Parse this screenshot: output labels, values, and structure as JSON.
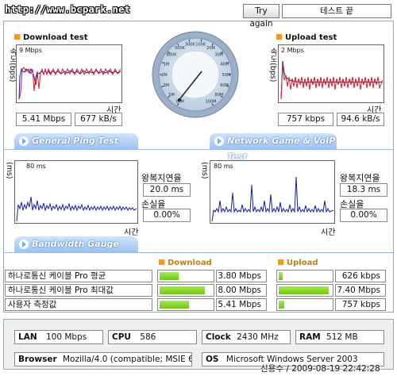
{
  "header": {
    "url_text": "http://www.bcpark.net",
    "try_again": "Try again",
    "status": "테스트 끝"
  },
  "download": {
    "title": "Download test",
    "y_axis": "속도(bps)",
    "y_max": "9 Mbps",
    "x_axis": "시간",
    "mbps": "5.41 Mbps",
    "kbs": "677 kB/s"
  },
  "upload": {
    "title": "Upload test",
    "y_axis": "속도(bps)",
    "y_max": "2 Mbps",
    "x_axis": "시간",
    "kbps": "757 kbps",
    "kbs": "94.6 kB/s"
  },
  "gauge": {
    "labels": [
      "10M",
      "5M",
      "3M",
      "2M",
      "1M",
      "800K",
      "500K",
      "300K",
      "100K",
      "20M",
      "30M",
      "40M",
      "50M",
      "60M",
      "80M",
      "100M"
    ],
    "needle_value": "5.41 Mbps"
  },
  "tabs": {
    "ping": "General Ping Test",
    "game": "Network Game & VoIP Test",
    "bandwidth": "Bandwidth Gauge"
  },
  "ping": {
    "y_axis": "(ms)",
    "y_max": "80 ms",
    "x_axis": "시간",
    "lat_label": "왕복지연율",
    "lat_val": "20.0 ms",
    "loss_label": "손실율",
    "loss_val": "0.00%"
  },
  "game": {
    "y_axis": "(ms)",
    "y_max": "80 ms",
    "x_axis": "시간",
    "lat_label": "왕복지연율",
    "lat_val": "18.3 ms",
    "loss_label": "손실율",
    "loss_val": "0.00%"
  },
  "bandwidth": {
    "download_header": "Download",
    "upload_header": "Upload",
    "rows": [
      {
        "label": "하나로통신 케이블 Pro 평균",
        "down": "3.80 Mbps",
        "down_frac": 0.36,
        "up": "626 kbps",
        "up_frac": 0.08
      },
      {
        "label": "하나로통신 케이블 Pro 최대값",
        "down": "8.00 Mbps",
        "down_frac": 0.84,
        "up": "7.40 Mbps",
        "up_frac": 0.93
      },
      {
        "label": "사용자 측정값",
        "down": "5.41 Mbps",
        "down_frac": 0.55,
        "up": "757 kbps",
        "up_frac": 0.1
      }
    ]
  },
  "sysinfo": {
    "lan_label": "LAN",
    "lan_val": "100 Mbps",
    "cpu_label": "CPU",
    "cpu_val": "586",
    "clock_label": "Clock",
    "clock_val": "2430 MHz",
    "ram_label": "RAM",
    "ram_val": "512 MB",
    "browser_label": "Browser",
    "browser_val": "Mozilla/4.0 (compatible; MSIE 6.0",
    "os_label": "OS",
    "os_val": "Microsoft Windows Server 2003"
  },
  "footer": {
    "stamp": "신용수 / 2009-08-19 22:42:28"
  }
}
